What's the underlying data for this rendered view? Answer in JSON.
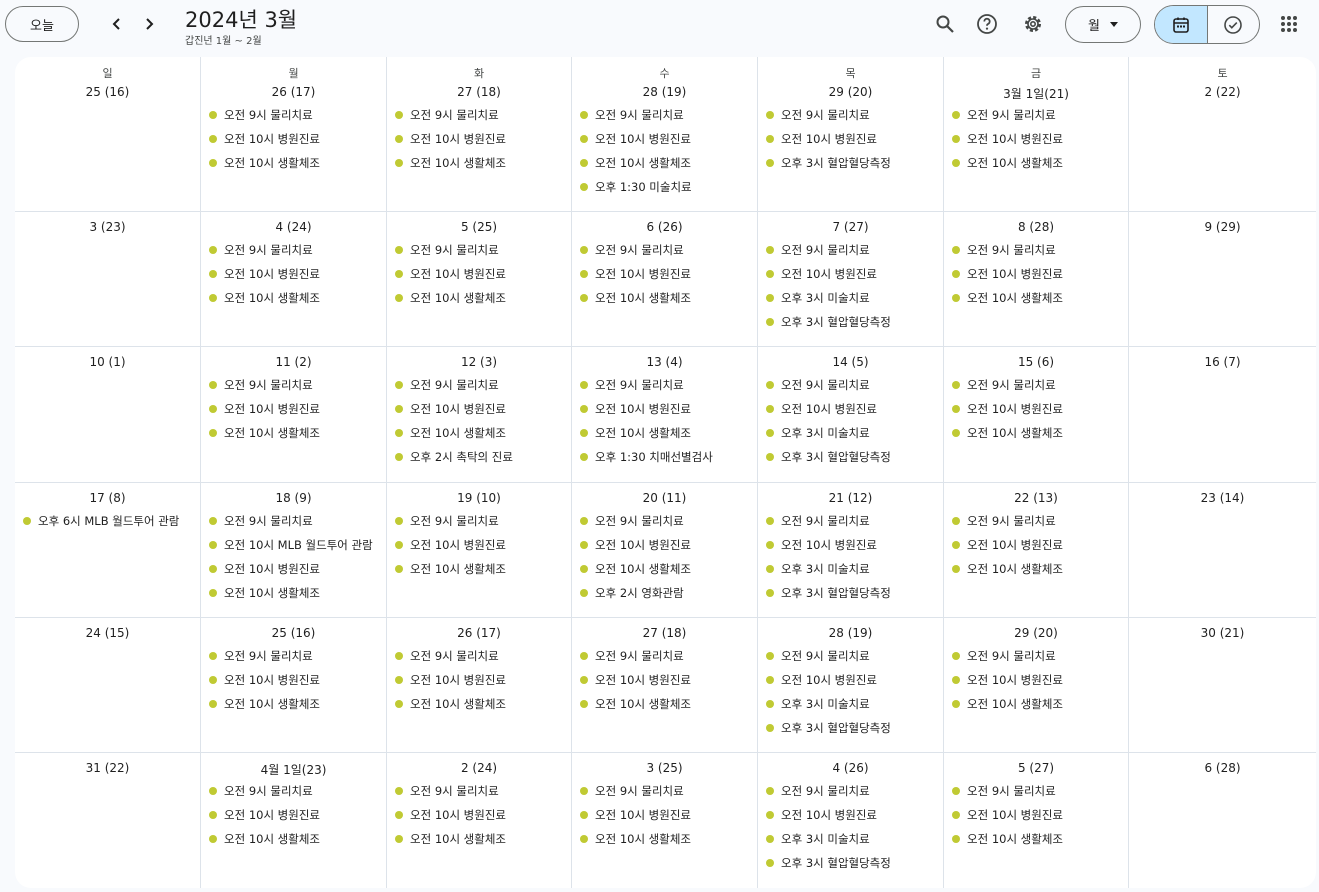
{
  "header": {
    "today_label": "오늘",
    "title": "2024년 3월",
    "subtitle": "갑진년 1월 ~ 2월",
    "view_label": "월",
    "icons": [
      "chevron-left-icon",
      "chevron-right-icon",
      "search-icon",
      "help-icon",
      "settings-icon",
      "calendar-icon",
      "task-check-icon",
      "apps-grid-icon"
    ]
  },
  "colors": {
    "event_dot": "#c0ca33",
    "active_toggle": "#c2e7ff",
    "grid_line": "#dde3ea"
  },
  "days_of_week": [
    "일",
    "월",
    "화",
    "수",
    "목",
    "금",
    "토"
  ],
  "weeks": [
    {
      "days": [
        {
          "date": "25 (16)",
          "events": []
        },
        {
          "date": "26 (17)",
          "events": [
            "오전 9시 물리치료",
            "오전 10시 병원진료",
            "오전 10시 생활체조"
          ]
        },
        {
          "date": "27 (18)",
          "events": [
            "오전 9시 물리치료",
            "오전 10시 병원진료",
            "오전 10시 생활체조"
          ]
        },
        {
          "date": "28 (19)",
          "events": [
            "오전 9시 물리치료",
            "오전 10시 병원진료",
            "오전 10시 생활체조",
            "오후 1:30 미술치료"
          ]
        },
        {
          "date": "29 (20)",
          "events": [
            "오전 9시 물리치료",
            "오전 10시 병원진료",
            "오후 3시 혈압혈당측정"
          ]
        },
        {
          "date": "3월 1일(21)",
          "events": [
            "오전 9시 물리치료",
            "오전 10시 병원진료",
            "오전 10시 생활체조"
          ]
        },
        {
          "date": "2 (22)",
          "events": []
        }
      ]
    },
    {
      "days": [
        {
          "date": "3 (23)",
          "events": []
        },
        {
          "date": "4 (24)",
          "events": [
            "오전 9시 물리치료",
            "오전 10시 병원진료",
            "오전 10시 생활체조"
          ]
        },
        {
          "date": "5 (25)",
          "events": [
            "오전 9시 물리치료",
            "오전 10시 병원진료",
            "오전 10시 생활체조"
          ]
        },
        {
          "date": "6 (26)",
          "events": [
            "오전 9시 물리치료",
            "오전 10시 병원진료",
            "오전 10시 생활체조"
          ]
        },
        {
          "date": "7 (27)",
          "events": [
            "오전 9시 물리치료",
            "오전 10시 병원진료",
            "오후 3시 미술치료",
            "오후 3시 혈압혈당측정"
          ]
        },
        {
          "date": "8 (28)",
          "events": [
            "오전 9시 물리치료",
            "오전 10시 병원진료",
            "오전 10시 생활체조"
          ]
        },
        {
          "date": "9 (29)",
          "events": []
        }
      ]
    },
    {
      "days": [
        {
          "date": "10 (1)",
          "events": []
        },
        {
          "date": "11 (2)",
          "events": [
            "오전 9시 물리치료",
            "오전 10시 병원진료",
            "오전 10시 생활체조"
          ]
        },
        {
          "date": "12 (3)",
          "events": [
            "오전 9시 물리치료",
            "오전 10시 병원진료",
            "오전 10시 생활체조",
            "오후 2시 촉탁의 진료"
          ]
        },
        {
          "date": "13 (4)",
          "events": [
            "오전 9시 물리치료",
            "오전 10시 병원진료",
            "오전 10시 생활체조",
            "오후 1:30 치매선별검사"
          ]
        },
        {
          "date": "14 (5)",
          "events": [
            "오전 9시 물리치료",
            "오전 10시 병원진료",
            "오후 3시 미술치료",
            "오후 3시 혈압혈당측정"
          ]
        },
        {
          "date": "15 (6)",
          "events": [
            "오전 9시 물리치료",
            "오전 10시 병원진료",
            "오전 10시 생활체조"
          ]
        },
        {
          "date": "16 (7)",
          "events": []
        }
      ]
    },
    {
      "days": [
        {
          "date": "17 (8)",
          "events": [
            "오후 6시 MLB 월드투어 관람"
          ]
        },
        {
          "date": "18 (9)",
          "events": [
            "오전 9시 물리치료",
            "오전 10시 MLB 월드투어 관람",
            "오전 10시 병원진료",
            "오전 10시 생활체조"
          ]
        },
        {
          "date": "19 (10)",
          "events": [
            "오전 9시 물리치료",
            "오전 10시 병원진료",
            "오전 10시 생활체조"
          ]
        },
        {
          "date": "20 (11)",
          "events": [
            "오전 9시 물리치료",
            "오전 10시 병원진료",
            "오전 10시 생활체조",
            "오후 2시 영화관람"
          ]
        },
        {
          "date": "21 (12)",
          "events": [
            "오전 9시 물리치료",
            "오전 10시 병원진료",
            "오후 3시 미술치료",
            "오후 3시 혈압혈당측정"
          ]
        },
        {
          "date": "22 (13)",
          "events": [
            "오전 9시 물리치료",
            "오전 10시 병원진료",
            "오전 10시 생활체조"
          ]
        },
        {
          "date": "23 (14)",
          "events": []
        }
      ]
    },
    {
      "days": [
        {
          "date": "24 (15)",
          "events": []
        },
        {
          "date": "25 (16)",
          "events": [
            "오전 9시 물리치료",
            "오전 10시 병원진료",
            "오전 10시 생활체조"
          ]
        },
        {
          "date": "26 (17)",
          "events": [
            "오전 9시 물리치료",
            "오전 10시 병원진료",
            "오전 10시 생활체조"
          ]
        },
        {
          "date": "27 (18)",
          "events": [
            "오전 9시 물리치료",
            "오전 10시 병원진료",
            "오전 10시 생활체조"
          ]
        },
        {
          "date": "28 (19)",
          "events": [
            "오전 9시 물리치료",
            "오전 10시 병원진료",
            "오후 3시 미술치료",
            "오후 3시 혈압혈당측정"
          ]
        },
        {
          "date": "29 (20)",
          "events": [
            "오전 9시 물리치료",
            "오전 10시 병원진료",
            "오전 10시 생활체조"
          ]
        },
        {
          "date": "30 (21)",
          "events": []
        }
      ]
    },
    {
      "days": [
        {
          "date": "31 (22)",
          "events": []
        },
        {
          "date": "4월 1일(23)",
          "events": [
            "오전 9시 물리치료",
            "오전 10시 병원진료",
            "오전 10시 생활체조"
          ]
        },
        {
          "date": "2 (24)",
          "events": [
            "오전 9시 물리치료",
            "오전 10시 병원진료",
            "오전 10시 생활체조"
          ]
        },
        {
          "date": "3 (25)",
          "events": [
            "오전 9시 물리치료",
            "오전 10시 병원진료",
            "오전 10시 생활체조"
          ]
        },
        {
          "date": "4 (26)",
          "events": [
            "오전 9시 물리치료",
            "오전 10시 병원진료",
            "오후 3시 미술치료",
            "오후 3시 혈압혈당측정"
          ]
        },
        {
          "date": "5 (27)",
          "events": [
            "오전 9시 물리치료",
            "오전 10시 병원진료",
            "오전 10시 생활체조"
          ]
        },
        {
          "date": "6 (28)",
          "events": []
        }
      ]
    }
  ]
}
